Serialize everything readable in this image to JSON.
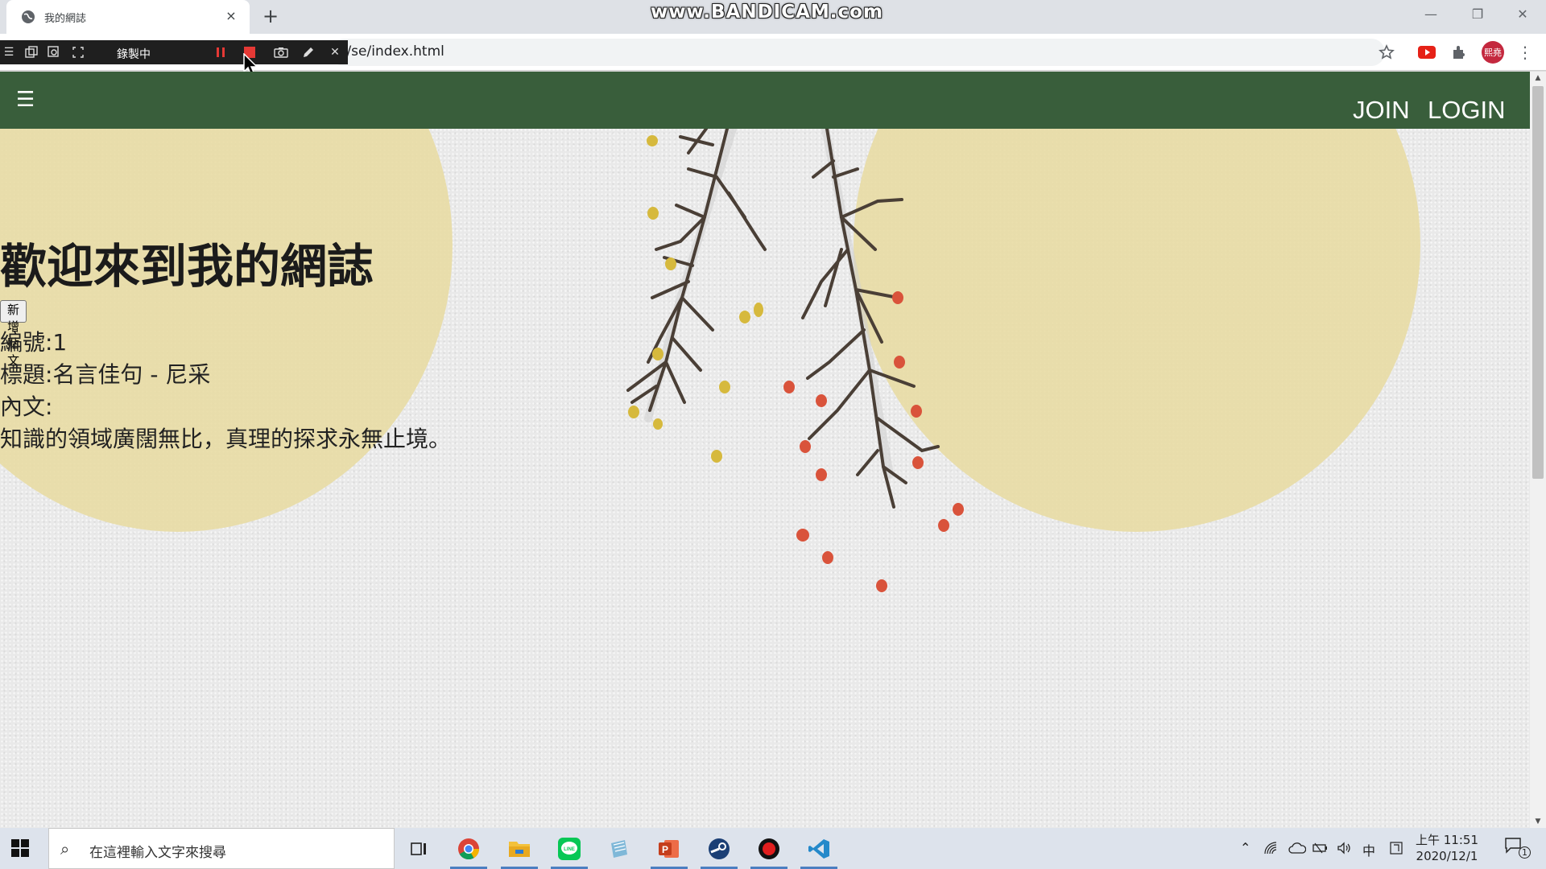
{
  "browser": {
    "tab_title": "我的網誌",
    "tab_close": "×",
    "new_tab": "+",
    "url": "e/se/index.html",
    "watermark": "www.BANDICAM.com",
    "profile_label": "熙堯",
    "window_controls": {
      "minimize": "—",
      "restore": "❐",
      "close": "✕"
    }
  },
  "recorder": {
    "status_label": "錄製中",
    "icons": [
      "menu-icon",
      "window-mode-icon",
      "region-mode-icon",
      "fullscreen-mode-icon",
      "pause-icon",
      "stop-icon",
      "camera-icon",
      "pencil-icon",
      "close-icon"
    ]
  },
  "navbar": {
    "menu_glyph": "☰",
    "join": "JOIN",
    "login": "LOGIN",
    "background_color": "#395e3b"
  },
  "page": {
    "heading": "歡迎來到我的網誌",
    "new_post_button": "新增貼文",
    "post": {
      "id_line": "編號:1",
      "title_line": "標題:名言佳句 - 尼采",
      "body_label": "內文:",
      "body_text": "知識的領域廣闊無比，真理的探求永無止境。"
    }
  },
  "taskbar": {
    "search_placeholder": "在這裡輸入文字來搜尋",
    "apps": [
      "task-view-icon",
      "chrome-icon",
      "file-explorer-icon",
      "line-icon",
      "notepad-icon",
      "powerpoint-icon",
      "steam-icon",
      "bandicam-icon",
      "vscode-icon"
    ],
    "tray": {
      "ime": "中",
      "time": "上午 11:51",
      "date": "2020/12/1",
      "notification_count": "1"
    }
  }
}
